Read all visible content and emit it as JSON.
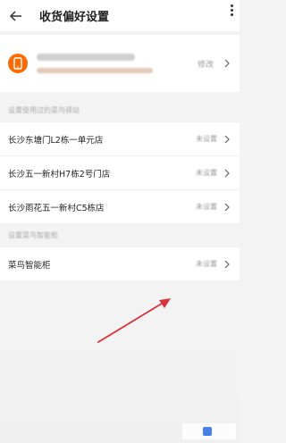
{
  "header": {
    "title": "收货偏好设置"
  },
  "phone": {
    "modify_label": "修改"
  },
  "section1": {
    "label": "设置使用过的菜鸟驿站"
  },
  "stations": [
    {
      "name": "长沙东塘门L2栋一单元店",
      "status": "未设置"
    },
    {
      "name": "长沙五一新村H7栋2号门店",
      "status": "未设置"
    },
    {
      "name": "长沙雨花五一新村C5栋店",
      "status": "未设置"
    }
  ],
  "section2": {
    "label": "设置菜鸟智能柜"
  },
  "smart_locker": {
    "name": "菜鸟智能柜",
    "status": "未设置"
  },
  "colors": {
    "accent": "#ff6a00",
    "arrow": "#d9323a"
  },
  "icons": {
    "back": "arrow-left-icon",
    "more": "more-vertical-icon",
    "phone": "phone-icon",
    "chevron": "chevron-right-icon"
  }
}
